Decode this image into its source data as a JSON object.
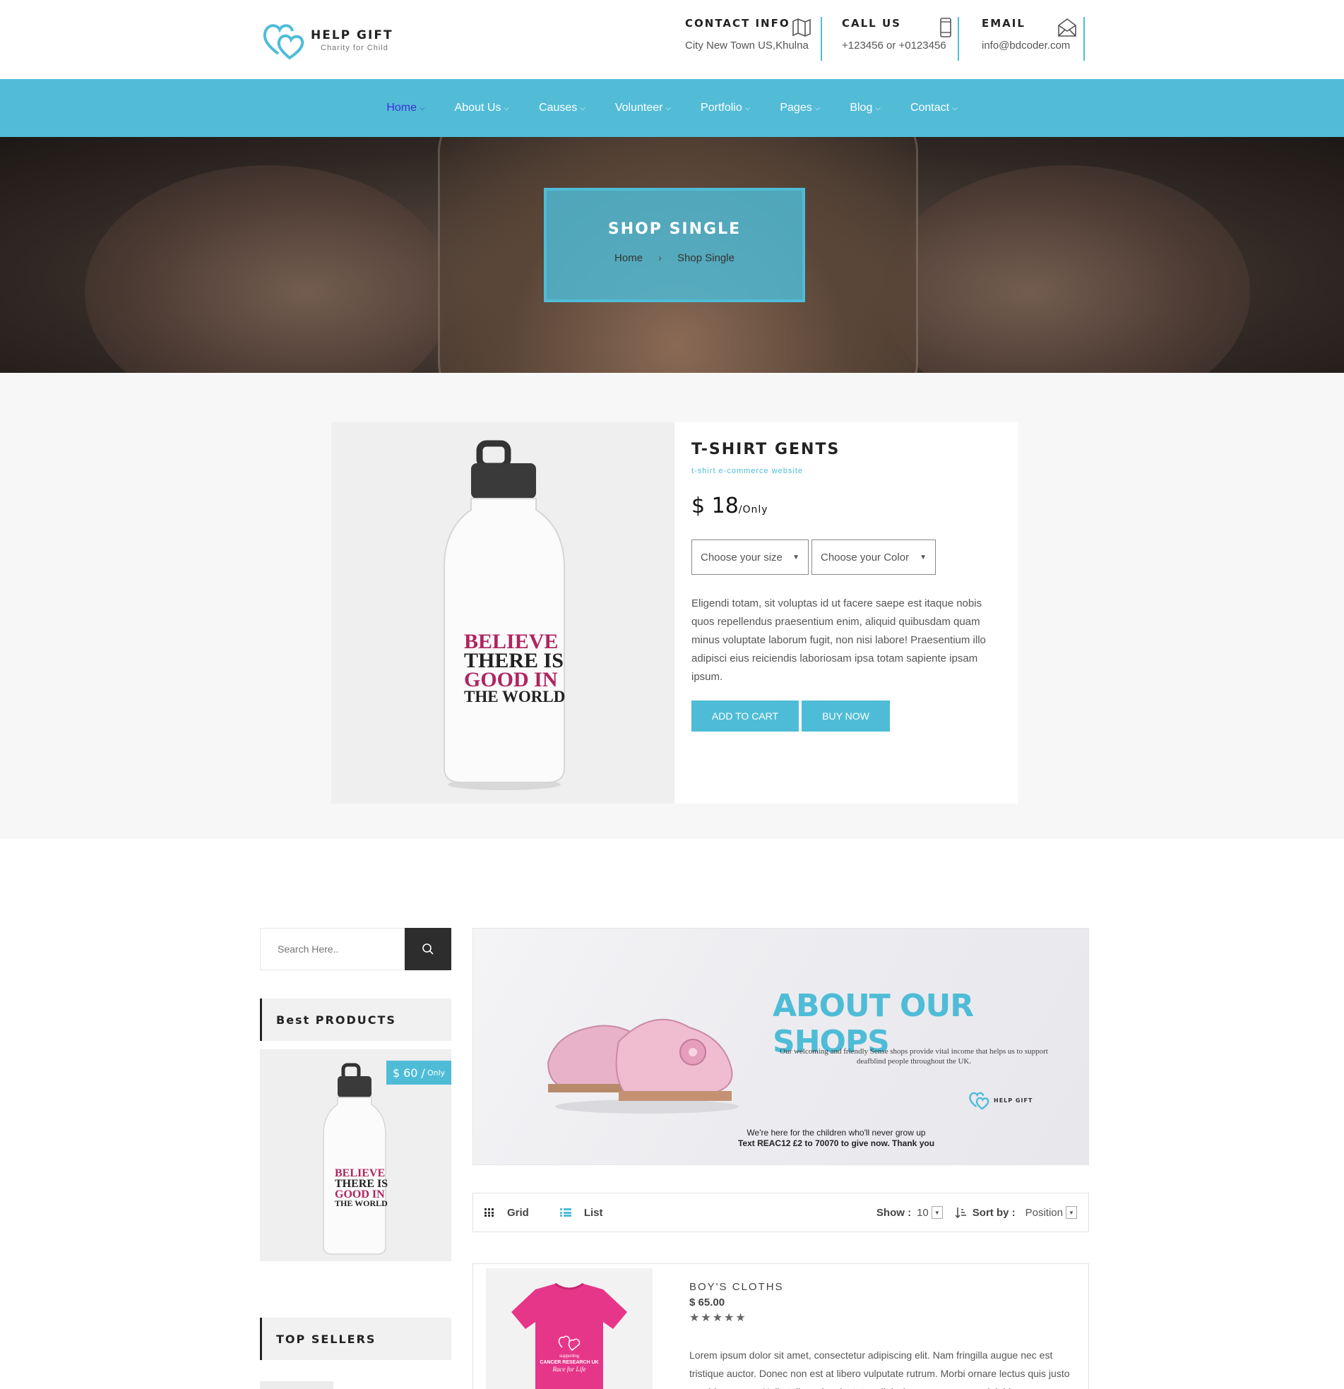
{
  "brand": {
    "name": "HELP GIFT",
    "tagline": "Charity for Child"
  },
  "contacts": [
    {
      "title": "CONTACT INFO",
      "value": "City New Town US,Khulna",
      "icon": "map-icon"
    },
    {
      "title": "CALL US",
      "value": "+123456 or +0123456",
      "icon": "phone-icon"
    },
    {
      "title": "EMAIL",
      "value": "info@bdcoder.com",
      "icon": "envelope-icon"
    }
  ],
  "nav": [
    "Home",
    "About Us",
    "Causes",
    "Volunteer",
    "Portfolio",
    "Pages",
    "Blog",
    "Contact"
  ],
  "hero": {
    "title": "SHOP SINGLE",
    "crumbs": [
      "Home",
      "Shop Single"
    ]
  },
  "product": {
    "title": "T-SHIRT GENTS",
    "subtitle": "t-shirt e-commerce website",
    "price": "$ 18",
    "price_suffix": "/Only",
    "size_select": "Choose your size",
    "color_select": "Choose your Color",
    "description": "Eligendi totam, sit voluptas id ut facere saepe est itaque nobis quos repellendus praesentium enim, aliquid quibusdam quam minus voluptate laborum fugit, non nisi labore! Praesentium illo adipisci eius reiciendis laboriosam ipsa totam sapiente ipsam ipsum.",
    "add_to_cart": "ADD TO CART",
    "buy_now": "BUY NOW",
    "bottle_text": [
      "BELIEVE",
      "THERE IS",
      "GOOD IN",
      "THE WORLD"
    ]
  },
  "sidebar": {
    "search_placeholder": "Search Here..",
    "best_products_title": "Best PRODUCTS",
    "best_price": "$ 60 /",
    "best_price_suffix": "Only",
    "top_sellers_title": "TOP SELLERS"
  },
  "banner": {
    "title": "ABOUT OUR SHOPS",
    "text": "Our welcoming and friendly Sense shops provide vital income that helps us to support deafblind people throughout the UK.",
    "tag_line1": "We're here for the children who'll never grow up",
    "tag_line2": "Text REAC12 £2 to 70070 to give now. Thank you",
    "logo_name": "HELP GIFT"
  },
  "toolbar": {
    "grid_label": "Grid",
    "list_label": "List",
    "show_label": "Show :",
    "show_value": "10",
    "sort_label": "Sort by :",
    "sort_value": "Position"
  },
  "list_item": {
    "title": "BOY'S CLOTHS",
    "price": "$ 65.00",
    "rating": 5,
    "stars": "★★★★★",
    "shirt_text1": "supporting",
    "shirt_text2": "CANCER RESEARCH UK",
    "shirt_text3": "Race for Life",
    "text": "Lorem ipsum dolor sit amet, consectetur adipiscing elit. Nam fringilla augue nec est tristique auctor. Donec non est at libero vulputate rutrum. Morbi ornare lectus quis justo gravida semper. Nulla tellus mi, vulputate adipiscing cursus eu, suscipit id"
  },
  "colors": {
    "accent": "#52bcd7",
    "active_nav": "#3b30d6",
    "dark": "#2d2d2d",
    "bottle_pink": "#b0245f"
  }
}
